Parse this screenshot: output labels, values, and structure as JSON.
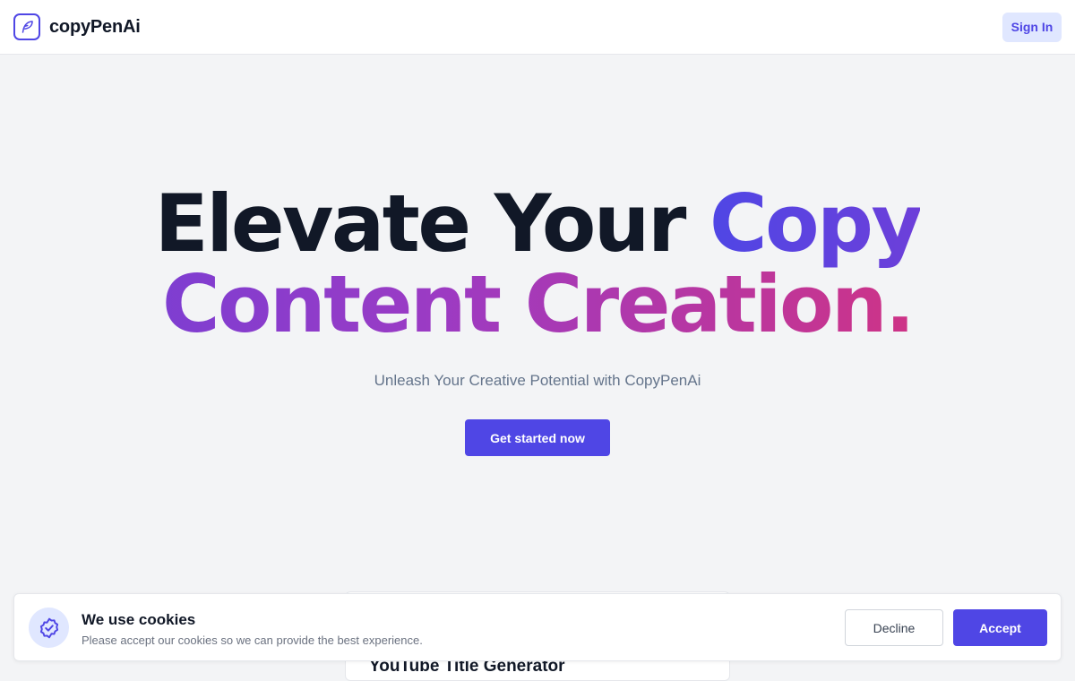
{
  "header": {
    "brand": "copyPenAi",
    "logo_icon": "feather-pen-icon",
    "signin_label": "Sign In"
  },
  "hero": {
    "headline_line1_dark": "Elevate Your ",
    "headline_line1_accent": "Copy",
    "headline_line2": "Content Creation.",
    "subtitle": "Unleash Your Creative Potential with CopyPenAi",
    "cta_label": "Get started now"
  },
  "peek_card": {
    "title": "YouTube Title Generator"
  },
  "cookie_banner": {
    "icon": "shield-check-icon",
    "title": "We use cookies",
    "text": "Please accept our cookies so we can provide the best experience.",
    "decline_label": "Decline",
    "accept_label": "Accept"
  },
  "colors": {
    "primary": "#4f46e5",
    "primary_light": "#e0e7ff",
    "gradient_end": "#e0306f",
    "background": "#f3f4f6"
  }
}
